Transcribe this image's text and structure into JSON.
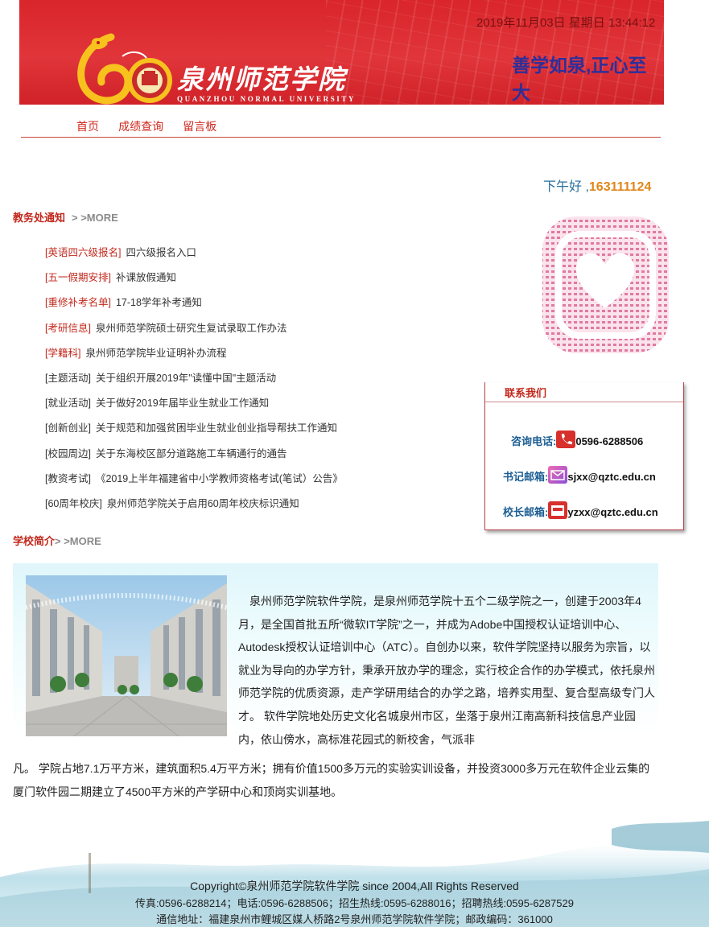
{
  "header": {
    "school_name": "泉州师范学院",
    "school_name_en": "QUANZHOU NORMAL UNIVERSITY",
    "datetime": "2019年11月03日 星期日 13:44:12",
    "motto": "善学如泉,正心至大"
  },
  "nav": {
    "items": [
      "首页",
      "成绩查询",
      "留言板"
    ]
  },
  "greeting": {
    "text": "下午好 ,",
    "user": "163111124"
  },
  "notices_section": {
    "title": "教务处通知",
    "more": "> >MORE",
    "items": [
      {
        "tag": "[英语四六级报名]",
        "text": "四六级报名入口"
      },
      {
        "tag": "[五一假期安排]",
        "text": "补课放假通知"
      },
      {
        "tag": "[重修补考名单]",
        "text": "17-18学年补考通知"
      },
      {
        "tag": "[考研信息]",
        "text": "泉州师范学院硕士研究生复试录取工作办法"
      },
      {
        "tag": "[学籍科]",
        "text": "泉州师范学院毕业证明补办流程"
      },
      {
        "tag": "[主题活动]",
        "text": "关于组织开展2019年\"读懂中国\"主题活动"
      },
      {
        "tag": "[就业活动]",
        "text": "关于做好2019年届毕业生就业工作通知"
      },
      {
        "tag": "[创新创业]",
        "text": "关于规范和加强贫困毕业生就业创业指导帮扶工作通知"
      },
      {
        "tag": "[校园周边]",
        "text": "关于东海校区部分道路施工车辆通行的通告"
      },
      {
        "tag": "[教资考试]",
        "text": "《2019上半年福建省中小学教师资格考试(笔试）公告》"
      },
      {
        "tag": "[60周年校庆]",
        "text": "泉州师范学院关于启用60周年校庆标识通知"
      }
    ]
  },
  "contact": {
    "title": "联系我们",
    "phone_label": "咨询电话:",
    "phone": "0596-6288506",
    "secretary_label": "书记邮箱:",
    "secretary_email": "sjxx@qztc.edu.cn",
    "president_label": "校长邮箱:",
    "president_email": "yzxx@qztc.edu.cn"
  },
  "intro_section": {
    "title": "学校简介",
    "more": "> >MORE",
    "paragraph_main": "泉州师范学院软件学院，是泉州师范学院十五个二级学院之一，创建于2003年4月，是全国首批五所“微软IT学院”之一，并成为Adobe中国授权认证培训中心、Autodesk授权认证培训中心（ATC）。自创办以来，软件学院坚持以服务为宗旨，以就业为导向的办学方针，秉承开放办学的理念，实行校企合作的办学模式，依托泉州师范学院的优质资源，走产学研用结合的办学之路，培养实用型、复合型高级专门人才。 软件学院地处历史文化名城泉州市区，坐落于泉州江南高新科技信息产业园内，依山傍水，高标准花园式的新校舍，气派非",
    "paragraph_cont": "凡。 学院占地7.1万平方米，建筑面积5.4万平方米；拥有价值1500多万元的实验实训设备，并投资3000多万元在软件企业云集的厦门软件园二期建立了4500平方米的产学研中心和顶岗实训基地。"
  },
  "footer": {
    "copyright": "Copyright©泉州师范学院软件学院 since 2004,All Rights Reserved",
    "phones": "传真:0596-6288214；电话:0596-6288506；招生热线:0595-6288016；招聘热线:0595-6287529",
    "address": "通信地址：福建泉州市鲤城区媒人桥路2号泉州师范学院软件学院；邮政编码：361000"
  },
  "colors": {
    "banner_red": "#d9252b",
    "nav_red": "#d0281d",
    "motto_blue": "#2c2f9a",
    "label_blue": "#1b5d93",
    "greeting_orange": "#e0861a"
  }
}
